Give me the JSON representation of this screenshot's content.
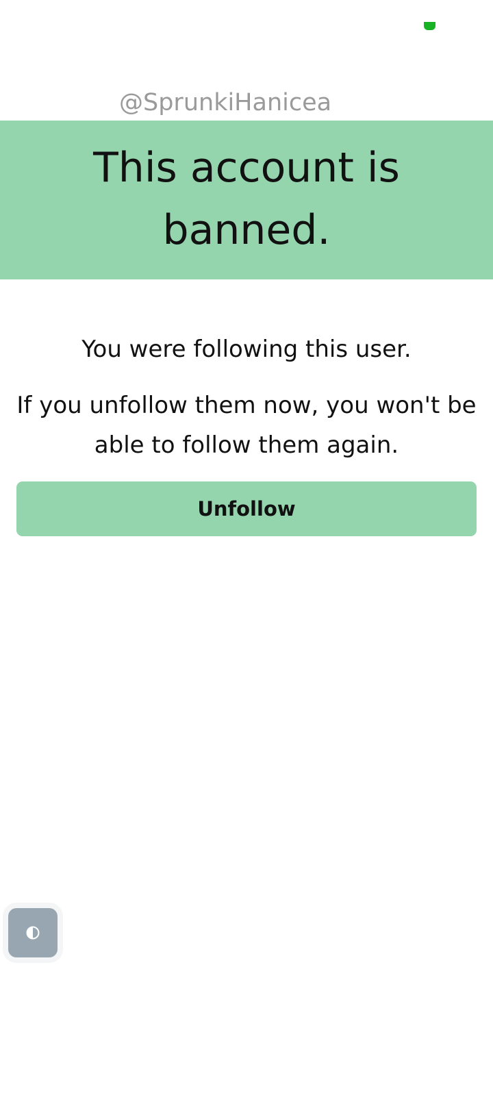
{
  "profile": {
    "username": "@SprunkiHanicea"
  },
  "banner": {
    "title": "This account is banned."
  },
  "messages": {
    "following": "You were following this user.",
    "warning": "If you unfollow them now, you won't be able to follow them again."
  },
  "actions": {
    "unfollow_label": "Unfollow"
  },
  "icons": {
    "status_indicator": "status-indicator-icon",
    "theme_toggle": "contrast-icon"
  },
  "colors": {
    "accent": "#94d5ae",
    "status": "#17b324",
    "username": "#9a9a9a",
    "theme_button": "#97a6b0"
  }
}
